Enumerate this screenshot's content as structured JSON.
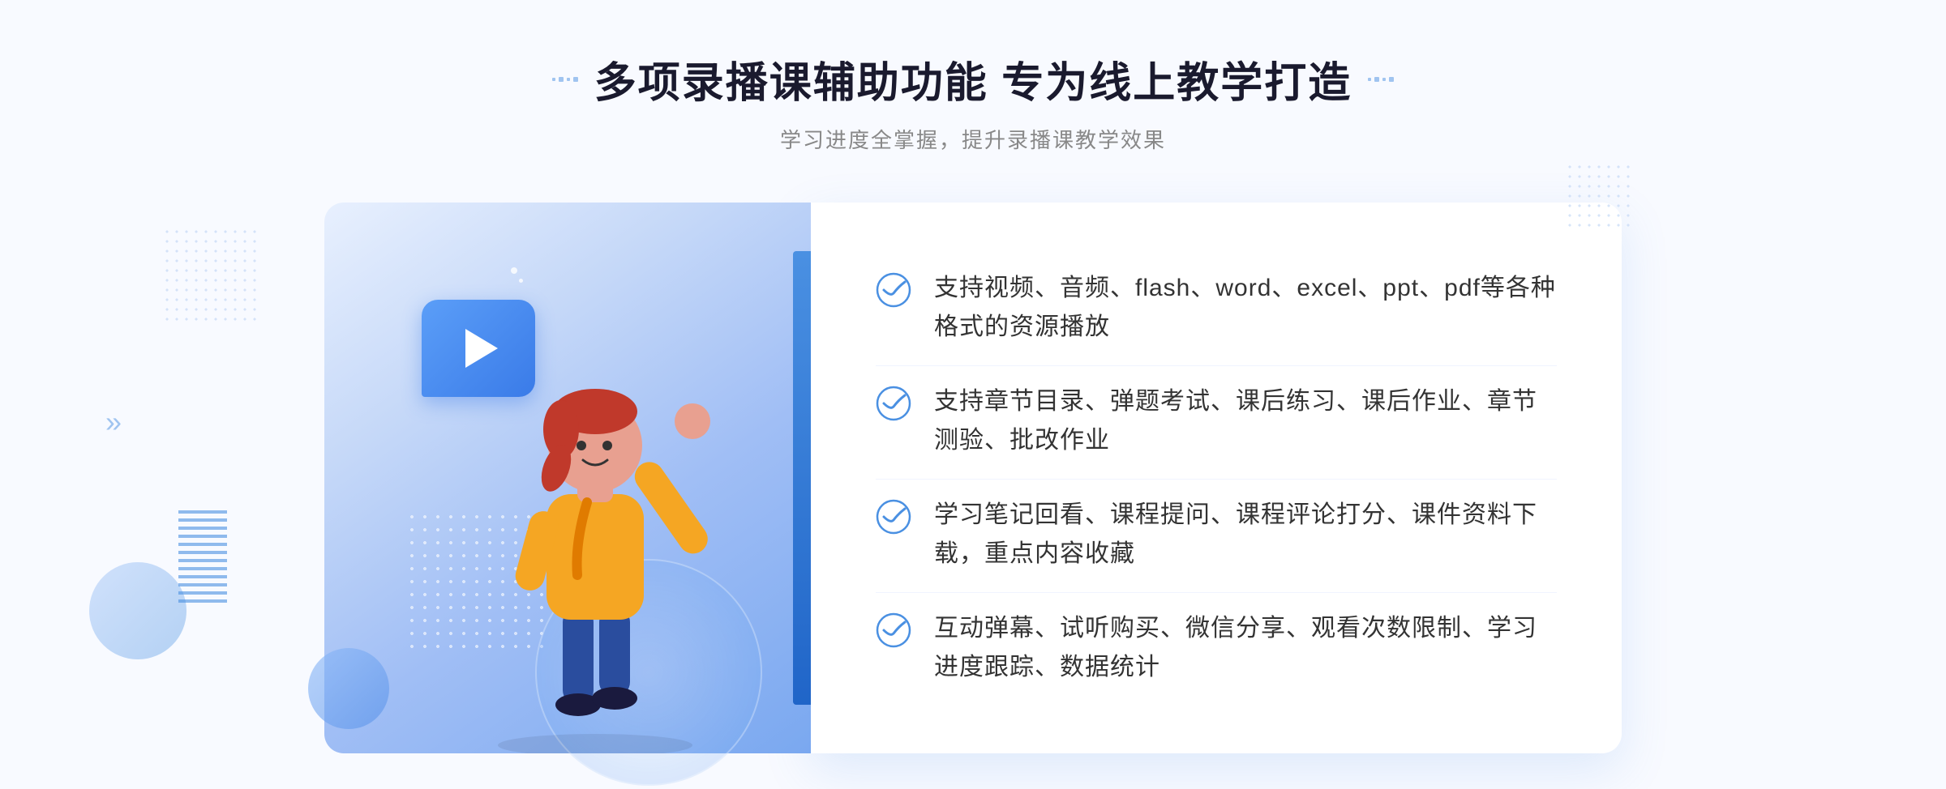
{
  "header": {
    "title": "多项录播课辅助功能 专为线上教学打造",
    "subtitle": "学习进度全掌握，提升录播课教学效果",
    "deco_left": "❖",
    "deco_right": "❖"
  },
  "features": [
    {
      "id": 1,
      "text": "支持视频、音频、flash、word、excel、ppt、pdf等各种格式的资源播放"
    },
    {
      "id": 2,
      "text": "支持章节目录、弹题考试、课后练习、课后作业、章节测验、批改作业"
    },
    {
      "id": 3,
      "text": "学习笔记回看、课程提问、课程评论打分、课件资料下载，重点内容收藏"
    },
    {
      "id": 4,
      "text": "互动弹幕、试听购买、微信分享、观看次数限制、学习进度跟踪、数据统计"
    }
  ],
  "colors": {
    "accent_blue": "#4a90e2",
    "dark_blue": "#2065c8",
    "light_bg": "#f8faff",
    "text_dark": "#1a1a2e",
    "text_gray": "#888888",
    "text_body": "#333333"
  },
  "icons": {
    "check": "circle-check",
    "play": "play-triangle",
    "chevron_left": "«",
    "chevron_right": "»"
  }
}
